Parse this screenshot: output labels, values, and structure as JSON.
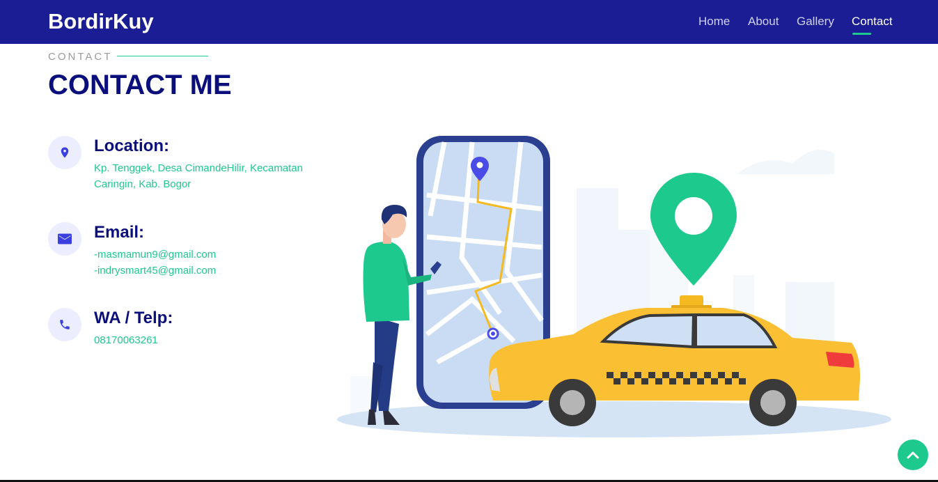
{
  "brand": "BordirKuy",
  "nav": {
    "items": [
      {
        "label": "Home"
      },
      {
        "label": "About"
      },
      {
        "label": "Gallery"
      },
      {
        "label": "Contact"
      }
    ],
    "active": "Contact"
  },
  "section": {
    "label": "CONTACT",
    "heading": "CONTACT ME"
  },
  "contact": {
    "location": {
      "title": "Location:",
      "line1": "Kp. Tenggek, Desa CimandeHilir, Kecamatan",
      "line2": "Caringin, Kab. Bogor",
      "icon": "map-pin-icon"
    },
    "email": {
      "title": "Email:",
      "line1": "-masmamun9@gmail.com",
      "line2": "-indrysmart45@gmail.com",
      "icon": "envelope-icon"
    },
    "phone": {
      "title": "WA / Telp:",
      "line1": "08170063261",
      "icon": "phone-icon"
    }
  },
  "colors": {
    "navbar": "#1a1d94",
    "heading": "#0b0f7c",
    "accent": "#1ec98d",
    "icon": "#3b3fe0",
    "taxi": "#fbbf33"
  },
  "illustration": {
    "icon": "taxi-app-illustration"
  },
  "back_to_top": {
    "icon": "chevron-up-icon"
  }
}
